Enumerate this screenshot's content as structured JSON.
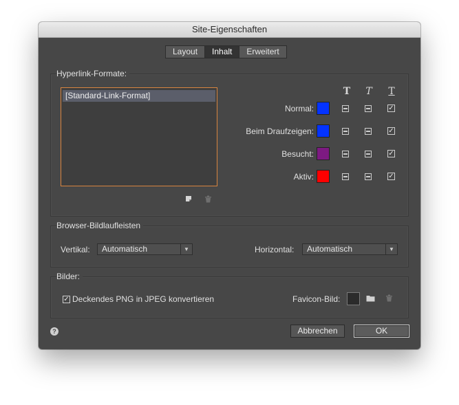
{
  "window": {
    "title": "Site-Eigenschaften"
  },
  "tabs": [
    {
      "label": "Layout",
      "active": false
    },
    {
      "label": "Inhalt",
      "active": true
    },
    {
      "label": "Erweitert",
      "active": false
    }
  ],
  "hyperlink": {
    "group_title": "Hyperlink-Formate:",
    "list_items": [
      "[Standard-Link-Format]"
    ],
    "column_icons": [
      "bold-t-icon",
      "italic-t-icon",
      "underline-t-icon"
    ],
    "rows": [
      {
        "label": "Normal:",
        "color": "#0433ff",
        "bold": "mixed",
        "italic": "mixed",
        "underline": "checked"
      },
      {
        "label": "Beim Draufzeigen:",
        "color": "#0433ff",
        "bold": "mixed",
        "italic": "mixed",
        "underline": "checked"
      },
      {
        "label": "Besucht:",
        "color": "#7d1a82",
        "bold": "mixed",
        "italic": "mixed",
        "underline": "checked"
      },
      {
        "label": "Aktiv:",
        "color": "#ff0000",
        "bold": "mixed",
        "italic": "mixed",
        "underline": "checked"
      }
    ]
  },
  "scrollbars": {
    "group_title": "Browser-Bildlaufleisten",
    "vertical_label": "Vertikal:",
    "vertical_value": "Automatisch",
    "horizontal_label": "Horizontal:",
    "horizontal_value": "Automatisch"
  },
  "images": {
    "group_title": "Bilder:",
    "convert_label": "Deckendes PNG in JPEG konvertieren",
    "convert_checked": true,
    "favicon_label": "Favicon-Bild:"
  },
  "footer": {
    "cancel_label": "Abbrechen",
    "ok_label": "OK"
  }
}
